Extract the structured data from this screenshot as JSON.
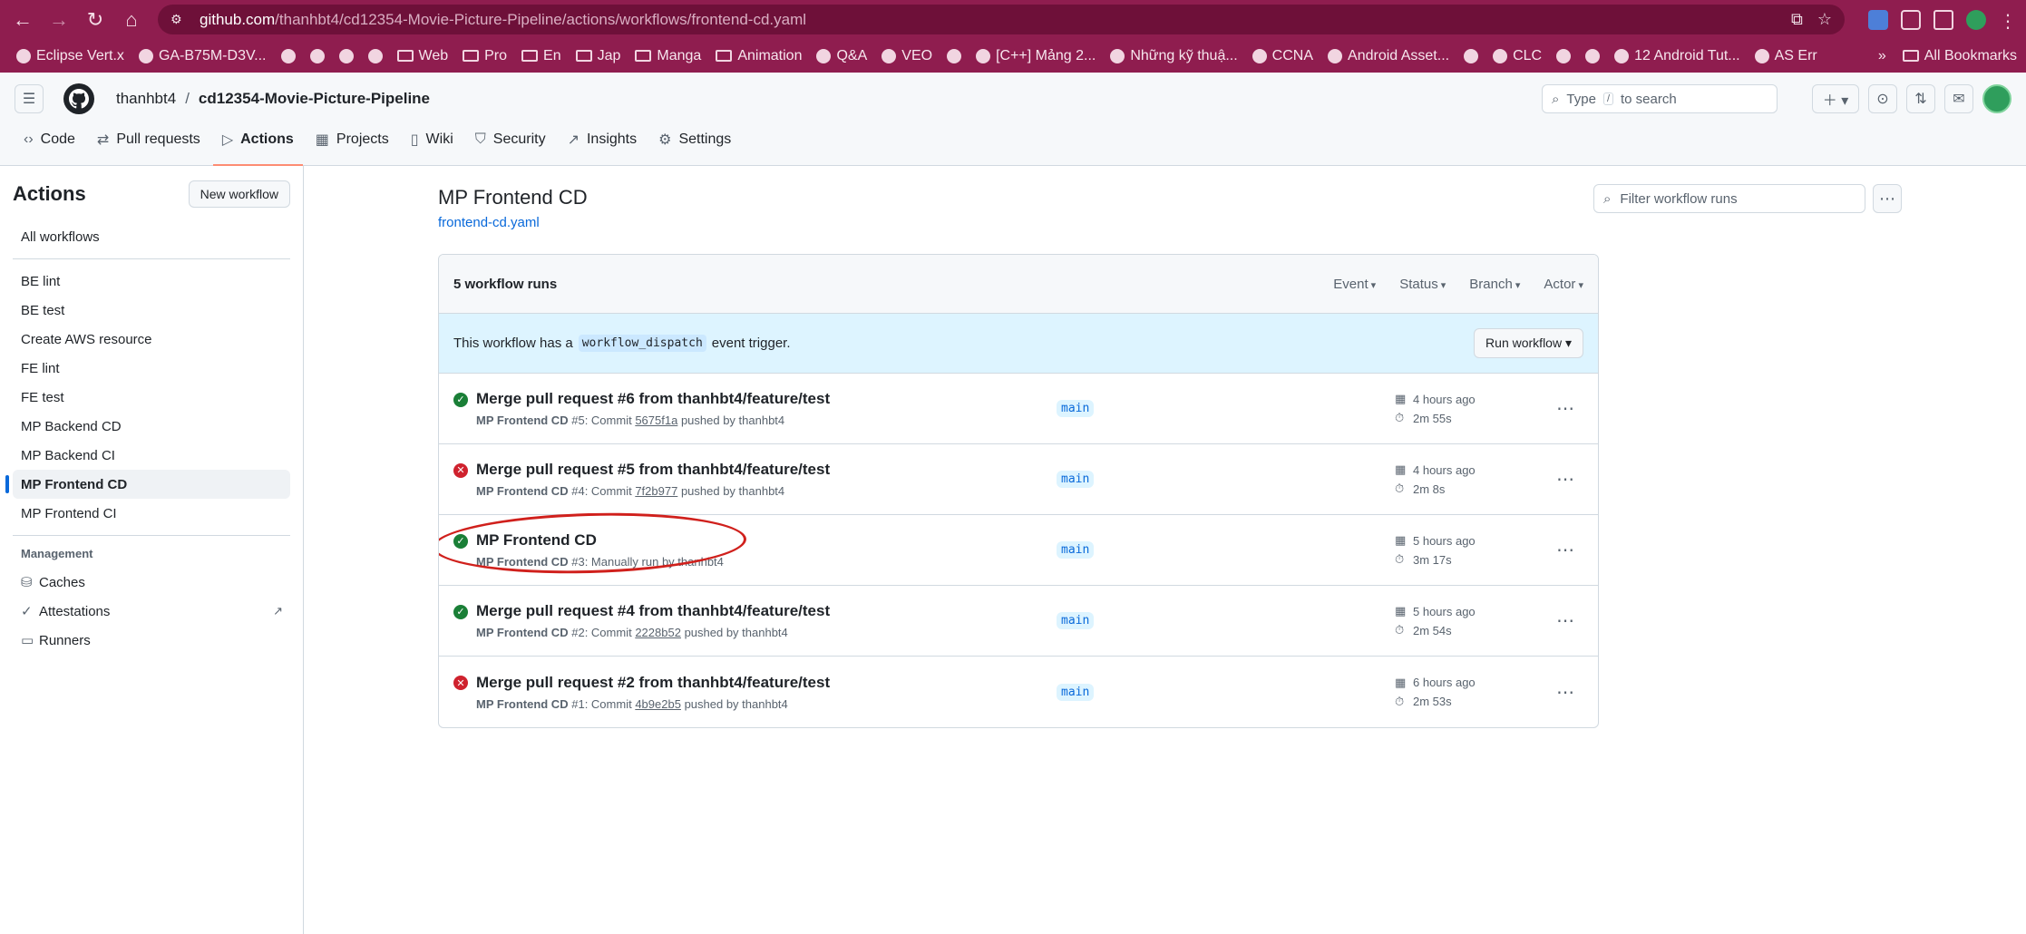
{
  "browser": {
    "url_host": "github.com",
    "url_path": "/thanhbt4/cd12354-Movie-Picture-Pipeline/actions/workflows/frontend-cd.yaml",
    "bookmarks": [
      "Eclipse Vert.x",
      "GA-B75M-D3V...",
      "",
      "",
      "",
      "",
      "Web",
      "Pro",
      "En",
      "Jap",
      "Manga",
      "Animation",
      "Q&A",
      "VEO",
      "",
      "[C++] Mảng 2...",
      "Những kỹ thuậ...",
      "CCNA",
      "Android Asset...",
      "",
      "CLC",
      "",
      "",
      "12 Android Tut...",
      "AS Err"
    ],
    "all_bookmarks": "All Bookmarks",
    "more": "»"
  },
  "header": {
    "owner": "thanhbt4",
    "separator": "/",
    "repo": "cd12354-Movie-Picture-Pipeline",
    "search_type": "Type",
    "search_key": "/",
    "search_rest": "to search"
  },
  "repo_nav": [
    {
      "label": "Code",
      "icon": "code-icon"
    },
    {
      "label": "Pull requests",
      "icon": "pull-request-icon"
    },
    {
      "label": "Actions",
      "icon": "play-icon"
    },
    {
      "label": "Projects",
      "icon": "table-icon"
    },
    {
      "label": "Wiki",
      "icon": "book-icon"
    },
    {
      "label": "Security",
      "icon": "shield-icon"
    },
    {
      "label": "Insights",
      "icon": "graph-icon"
    },
    {
      "label": "Settings",
      "icon": "gear-icon"
    }
  ],
  "sidebar": {
    "title": "Actions",
    "new_workflow": "New workflow",
    "all_workflows": "All workflows",
    "workflows": [
      "BE lint",
      "BE test",
      "Create AWS resource",
      "FE lint",
      "FE test",
      "MP Backend CD",
      "MP Backend CI",
      "MP Frontend CD",
      "MP Frontend CI"
    ],
    "active_index": 7,
    "management_label": "Management",
    "management": [
      "Caches",
      "Attestations",
      "Runners"
    ]
  },
  "content": {
    "title": "MP Frontend CD",
    "file": "frontend-cd.yaml",
    "filter_placeholder": "Filter workflow runs",
    "runs_count": "5 workflow runs",
    "filters": [
      "Event",
      "Status",
      "Branch",
      "Actor"
    ],
    "dispatch_pre": "This workflow has a",
    "dispatch_code": "workflow_dispatch",
    "dispatch_post": "event trigger.",
    "run_workflow": "Run workflow",
    "runs": [
      {
        "status": "success",
        "title": "Merge pull request #6 from thanhbt4/feature/test",
        "workflow": "MP Frontend CD",
        "num": "#5",
        "pre": ": Commit",
        "commit": "5675f1a",
        "post": "pushed by thanhbt4",
        "branch": "main",
        "when": "4 hours ago",
        "duration": "2m 55s"
      },
      {
        "status": "failure",
        "title": "Merge pull request #5 from thanhbt4/feature/test",
        "workflow": "MP Frontend CD",
        "num": "#4",
        "pre": ": Commit",
        "commit": "7f2b977",
        "post": "pushed by thanhbt4",
        "branch": "main",
        "when": "4 hours ago",
        "duration": "2m 8s"
      },
      {
        "status": "success",
        "title": "MP Frontend CD",
        "workflow": "MP Frontend CD",
        "num": "#3",
        "pre": ": Manually run by thanhbt4",
        "commit": "",
        "post": "",
        "branch": "main",
        "when": "5 hours ago",
        "duration": "3m 17s"
      },
      {
        "status": "success",
        "title": "Merge pull request #4 from thanhbt4/feature/test",
        "workflow": "MP Frontend CD",
        "num": "#2",
        "pre": ": Commit",
        "commit": "2228b52",
        "post": "pushed by thanhbt4",
        "branch": "main",
        "when": "5 hours ago",
        "duration": "2m 54s"
      },
      {
        "status": "failure",
        "title": "Merge pull request #2 from thanhbt4/feature/test",
        "workflow": "MP Frontend CD",
        "num": "#1",
        "pre": ": Commit",
        "commit": "4b9e2b5",
        "post": "pushed by thanhbt4",
        "branch": "main",
        "when": "6 hours ago",
        "duration": "2m 53s"
      }
    ]
  },
  "colors": {
    "accent": "#0969da",
    "success": "#1a7f37",
    "failure": "#cf222e",
    "annotation": "#d0201c",
    "browser_chrome": "#8f1d4f"
  }
}
